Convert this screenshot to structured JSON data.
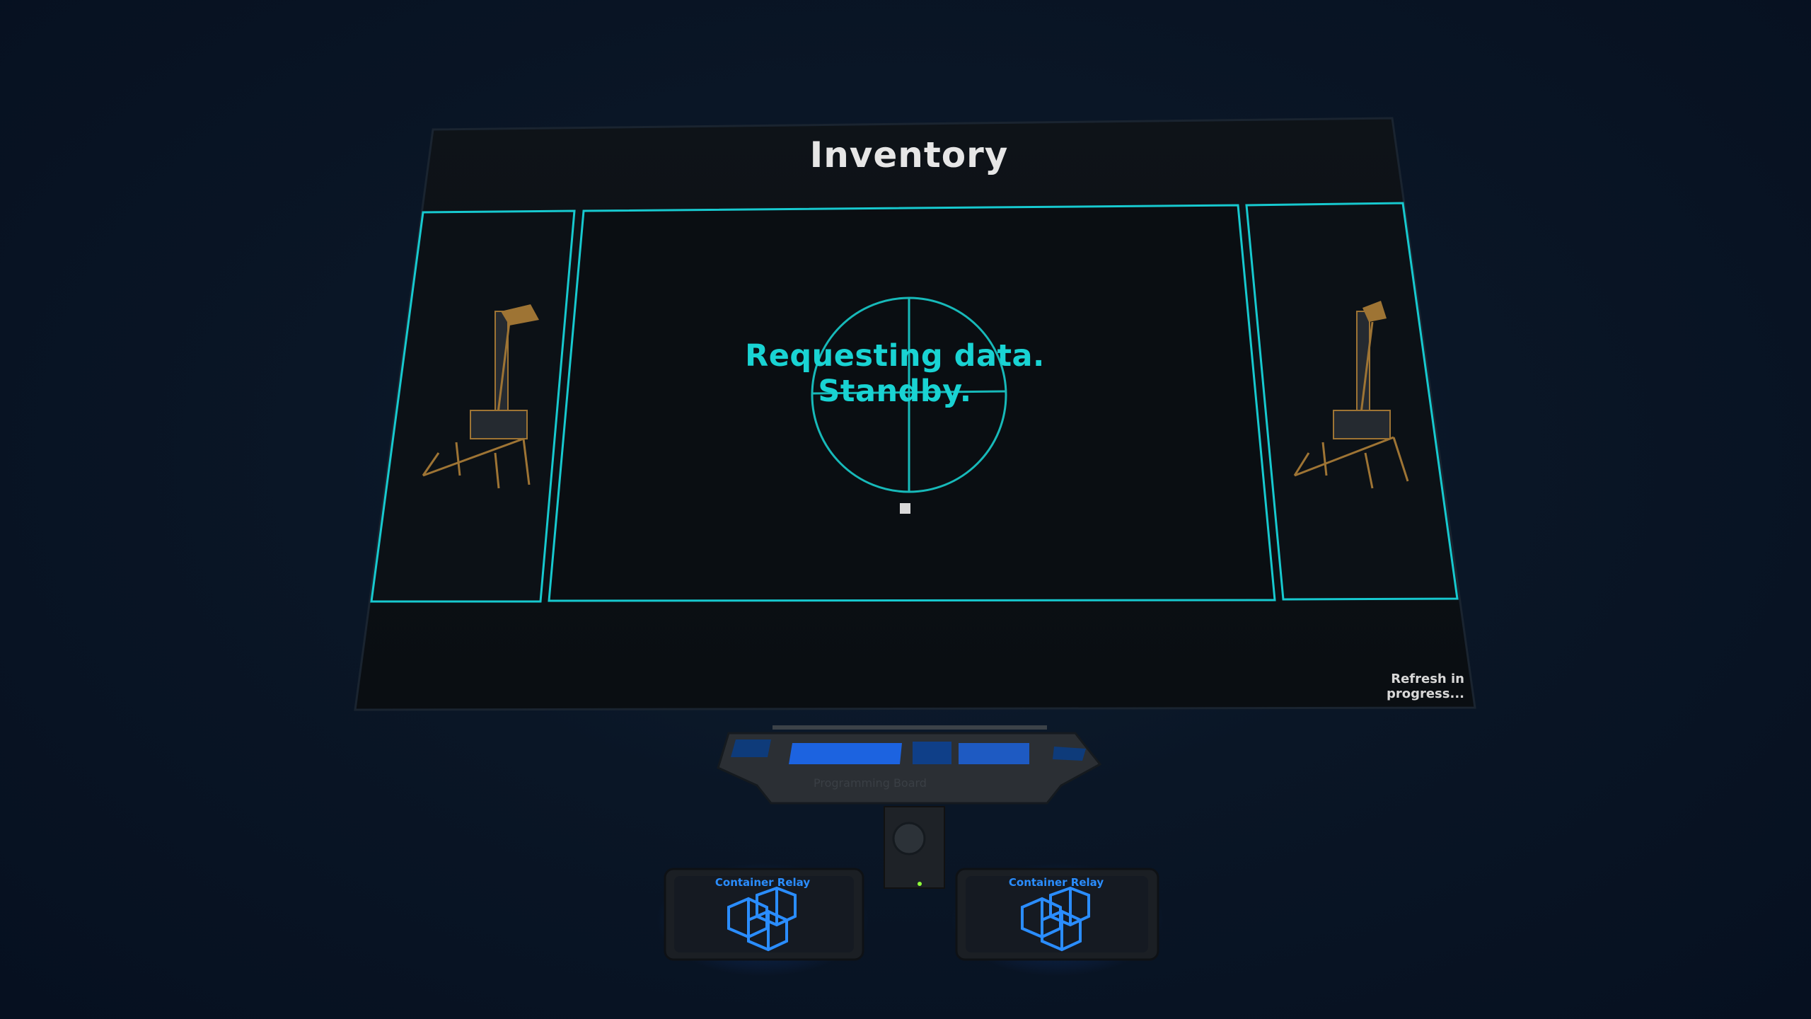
{
  "screen": {
    "title": "Inventory",
    "status_message": "Requesting data. Standby.",
    "refresh_status": "Refresh in progress..."
  },
  "devices": {
    "programming_board": {
      "label": "Programming Board"
    },
    "relays": [
      {
        "label": "Container Relay"
      },
      {
        "label": "Container Relay"
      }
    ]
  },
  "colors": {
    "accent": "#19d3d3",
    "screen_bg": "#0b0f14",
    "relay_accent": "#2a8dff",
    "crane_accent": "#b8863a"
  },
  "icons": {
    "loading": "crosshair-circle-icon",
    "left_panel": "industry-crane-icon",
    "right_panel": "industry-crane-icon",
    "relay": "container-cubes-icon"
  }
}
